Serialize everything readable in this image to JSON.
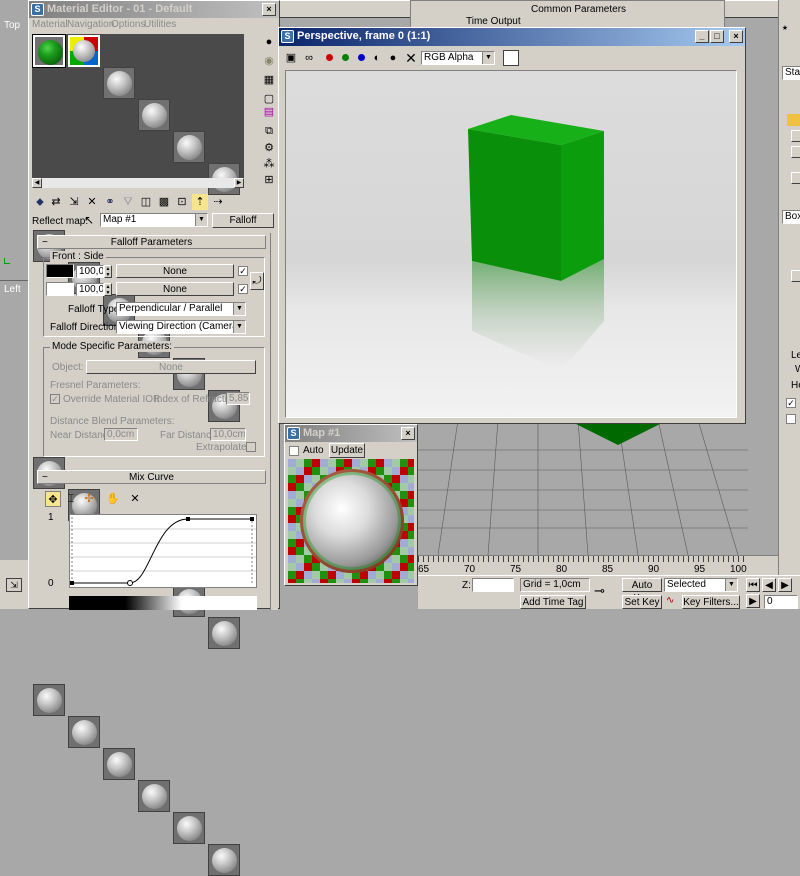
{
  "material_editor": {
    "title": "Material Editor - 01 - Default",
    "menu": [
      "Material",
      "Navigation",
      "Options",
      "Utilities"
    ],
    "reflect_map_label": "Reflect map:",
    "map_name": "Map #1",
    "map_type": "Falloff",
    "falloff_rollout": {
      "title": "Falloff Parameters",
      "front_side_label": "Front : Side",
      "slots": [
        {
          "swatch": "#000000",
          "value": "100,0",
          "map": "None",
          "checked": "✓"
        },
        {
          "swatch": "#ffffff",
          "value": "100,0",
          "map": "None",
          "checked": "✓"
        }
      ],
      "swap_icon": "swap-arrows-icon",
      "falloff_type_label": "Falloff Type:",
      "falloff_type_value": "Perpendicular / Parallel",
      "falloff_direction_label": "Falloff Direction:",
      "falloff_direction_value": "Viewing Direction (Camera Z-Axis)"
    },
    "mode_specific": {
      "title": "Mode Specific Parameters:",
      "object_label": "Object:",
      "object_value": "None",
      "fresnel_label": "Fresnel Parameters:",
      "override_label": "Override Material IOR",
      "override_checked": "✓",
      "ior_label": "Index of Refraction",
      "ior_value": "5,85",
      "distance_label": "Distance Blend Parameters:",
      "near_label": "Near Distance:",
      "near_value": "0,0cm",
      "far_label": "Far Distance:",
      "far_value": "10,0cm",
      "extrapolate_label": "Extrapolate"
    },
    "mix_curve": {
      "title": "Mix Curve",
      "y_top": "1",
      "y_bottom": "0"
    }
  },
  "perspective_window": {
    "title": "Perspective, frame 0 (1:1)",
    "channel_value": "RGB Alpha",
    "channel_colors": [
      "#d00000",
      "#008000",
      "#0000d0"
    ]
  },
  "map_window": {
    "title": "Map #1",
    "auto_label": "Auto",
    "update_label": "Update"
  },
  "viewport_top": {
    "label": "Top",
    "common_params": "Common Parameters",
    "time_output": "Time Output"
  },
  "viewport_left": {
    "label": "Left"
  },
  "right_panel": {
    "texts": [
      "Stan",
      "Box",
      "Le",
      "W",
      "He"
    ]
  },
  "timeline": {
    "ticks": [
      "65",
      "70",
      "75",
      "80",
      "85",
      "90",
      "95",
      "100"
    ]
  },
  "statusbar": {
    "z_label": "Z:",
    "grid_text": "Grid = 1,0cm",
    "add_time_tag": "Add Time Tag",
    "auto_key": "Auto Key",
    "selected": "Selected",
    "set_key": "Set Key",
    "key_filters": "Key Filters...",
    "frame_value": "0"
  }
}
